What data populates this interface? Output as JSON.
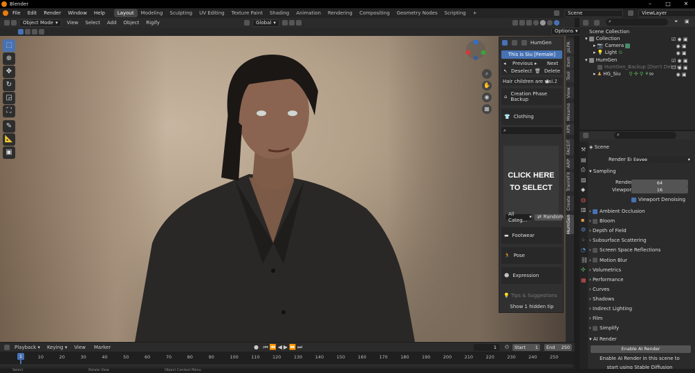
{
  "window": {
    "title": "Blender"
  },
  "menu": {
    "items": [
      "File",
      "Edit",
      "Render",
      "Window",
      "Help"
    ],
    "workspaces": [
      "Layout",
      "Modeling",
      "Sculpting",
      "UV Editing",
      "Texture Paint",
      "Shading",
      "Animation",
      "Rendering",
      "Compositing",
      "Geometry Nodes",
      "Scripting",
      "+"
    ],
    "scene": "Scene",
    "view_layer": "ViewLayer"
  },
  "viewport_header": {
    "mode": "Object Mode",
    "menus": [
      "View",
      "Select",
      "Add",
      "Object",
      "Rigify"
    ],
    "transform": "Global",
    "options": "Options"
  },
  "humgen": {
    "panel_title": "HumGen",
    "character": "This is Siu [Female]",
    "previous": "Previous",
    "next": "Next",
    "deselect": "Deselect",
    "delete": "Delete",
    "hair_note": "Hair children are visi...",
    "creation_backup": "Creation Phase Backup",
    "clothing": "Clothing",
    "click_here": "CLICK HERE",
    "to_select": "TO SELECT",
    "category": "All Categ...",
    "random": "Random",
    "footwear": "Footwear",
    "pose": "Pose",
    "expression": "Expression",
    "tips": "Tips & Suggestions",
    "hidden_tip": "Show 1 hidden tip"
  },
  "side_tabs": [
    "pLPA",
    "Item",
    "Tool",
    "View",
    "Mixamo",
    "XPS",
    "FACEIT",
    "ARP",
    "TrainVFX",
    "Create",
    "HumGen"
  ],
  "outliner": {
    "rows": [
      {
        "label": "Scene Collection",
        "indent": 0
      },
      {
        "label": "Collection",
        "indent": 1
      },
      {
        "label": "Camera",
        "indent": 2
      },
      {
        "label": "Light",
        "indent": 2
      },
      {
        "label": "HumGen",
        "indent": 1
      },
      {
        "label": "HumGen_Backup [Don't Delete]",
        "indent": 2
      },
      {
        "label": "HG_Siu",
        "indent": 2
      }
    ],
    "hg_count": "99"
  },
  "properties": {
    "scene": "Scene",
    "render_engine_label": "Render Engine",
    "render_engine": "Eevee",
    "sampling": "Sampling",
    "render_label": "Render",
    "render_value": "64",
    "viewport_label": "Viewport",
    "viewport_value": "16",
    "viewport_denoising": "Viewport Denoising",
    "sections": [
      {
        "label": "Ambient Occlusion",
        "check": "on"
      },
      {
        "label": "Bloom",
        "check": "off"
      },
      {
        "label": "Depth of Field",
        "check": "none"
      },
      {
        "label": "Subsurface Scattering",
        "check": "none"
      },
      {
        "label": "Screen Space Reflections",
        "check": "off"
      },
      {
        "label": "Motion Blur",
        "check": "off"
      },
      {
        "label": "Volumetrics",
        "check": "none"
      },
      {
        "label": "Performance",
        "check": "none"
      },
      {
        "label": "Curves",
        "check": "none"
      },
      {
        "label": "Shadows",
        "check": "none"
      },
      {
        "label": "Indirect Lighting",
        "check": "none"
      },
      {
        "label": "Film",
        "check": "none"
      },
      {
        "label": "Simplify",
        "check": "off"
      }
    ],
    "ai_render": "AI Render",
    "enable_ai_render": "Enable AI Render",
    "ai_line1": "Enable AI Render in this scene to",
    "ai_line2": "start using Stable Diffusion"
  },
  "timeline": {
    "menus": [
      "Playback",
      "Keying",
      "View",
      "Marker"
    ],
    "current_frame": "1",
    "start_label": "Start",
    "start": "1",
    "end_label": "End",
    "end": "250",
    "ticks": [
      "1",
      "10",
      "20",
      "30",
      "40",
      "50",
      "60",
      "70",
      "80",
      "90",
      "100",
      "110",
      "120",
      "130",
      "140",
      "150",
      "160",
      "170",
      "180",
      "190",
      "200",
      "210",
      "220",
      "230",
      "240",
      "250"
    ]
  },
  "status": [
    "Select",
    "Rotate View",
    "Object Context Menu"
  ],
  "colors": {
    "accent": "#4772b3",
    "orange": "#e87d0d",
    "bg": "#1d1d1d"
  }
}
